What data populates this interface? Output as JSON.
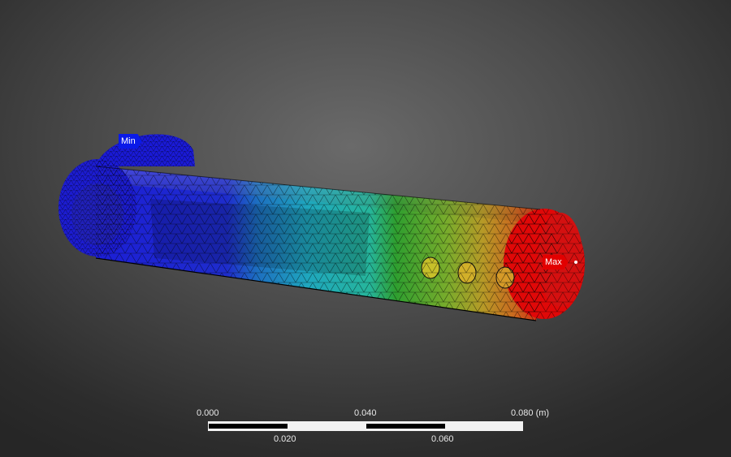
{
  "probes": {
    "min_label": "Min",
    "max_label": "Max"
  },
  "scale_bar": {
    "top_labels": [
      "0.000",
      "0.040",
      "0.080 (m)"
    ],
    "bottom_labels": [
      "0.020",
      "0.060"
    ]
  },
  "colors": {
    "min": "#0a1ae8",
    "max": "#e20000",
    "background": "#4b4b4b",
    "contour": [
      "#1a1ad8",
      "#1e58c8",
      "#1e9bc0",
      "#2db8a8",
      "#2ea02e",
      "#6cb02c",
      "#b8a028",
      "#c87020",
      "#d42010"
    ]
  }
}
